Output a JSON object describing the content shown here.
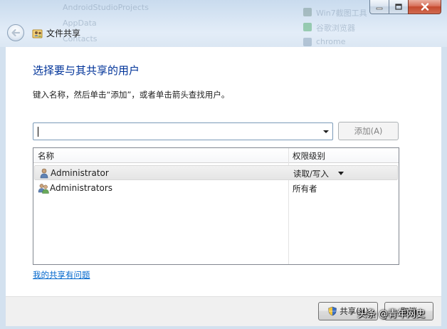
{
  "window": {
    "title": "文件共享",
    "background_text": [
      "AndroidStudioProjects",
      "AppData",
      "Contacts",
      "Win7截图工具",
      "谷歌浏览器",
      "chrome"
    ]
  },
  "dialog": {
    "heading": "选择要与其共享的用户",
    "instruction": "键入名称，然后单击“添加”，或者单击箭头查找用户。",
    "name_input": {
      "value": "",
      "placeholder": ""
    },
    "add_button_label": "添加(A)",
    "table": {
      "columns": [
        "名称",
        "权限级别"
      ],
      "rows": [
        {
          "name": "Administrator",
          "permission": "读取/写入",
          "icon": "user-icon",
          "has_dropdown": true
        },
        {
          "name": "Administrators",
          "permission": "所有者",
          "icon": "users-group-icon",
          "has_dropdown": false
        }
      ]
    },
    "help_link": "我的共享有问题"
  },
  "footer": {
    "share_button_label": "共享(H)",
    "cancel_button_label": "取消"
  },
  "watermark": "头条 @青年网史",
  "colors": {
    "heading": "#003399",
    "link": "#0066cc",
    "close_button": "#c44a2f"
  }
}
